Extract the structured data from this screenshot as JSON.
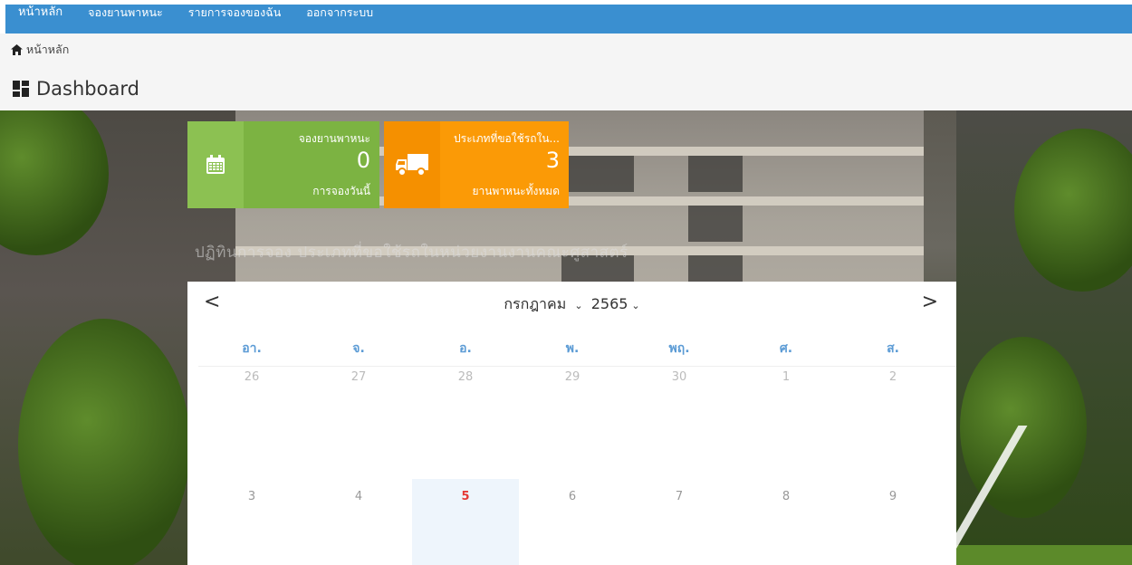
{
  "nav": {
    "items": [
      "หน้าหลัก",
      "จองยานพาหนะ",
      "รายการจองของฉัน",
      "ออกจากระบบ"
    ]
  },
  "breadcrumb": {
    "label": "หน้าหลัก",
    "icon": "home-icon"
  },
  "page": {
    "title": "Dashboard",
    "icon": "dashboard-icon"
  },
  "photo": {
    "caption": "ปฏิทินการจอง ประเภทที่ขอใช้รถในหน่วยงานงานคณะศูสาสตร์"
  },
  "tiles": [
    {
      "title": "จองยานพาหนะ",
      "value": "0",
      "sub": "การจองวันนี้",
      "icon": "calendar-icon",
      "color": "#7cb342"
    },
    {
      "title": "ประเภทที่ขอใช้รถใน...",
      "value": "3",
      "sub": "ยานพาหนะทั้งหมด",
      "icon": "truck-icon",
      "color": "#fb9a06"
    }
  ],
  "calendar": {
    "prev": "<",
    "next": ">",
    "month": "กรกฎาคม",
    "year": "2565",
    "dow": [
      "อา.",
      "จ.",
      "อ.",
      "พ.",
      "พฤ.",
      "ศ.",
      "ส."
    ],
    "week1": [
      "26",
      "27",
      "28",
      "29",
      "30",
      "1",
      "2"
    ],
    "week2": [
      "3",
      "4",
      "5",
      "6",
      "7",
      "8",
      "9"
    ],
    "today": "5",
    "accent": "#5b9bd5",
    "today_color": "#e53935"
  }
}
